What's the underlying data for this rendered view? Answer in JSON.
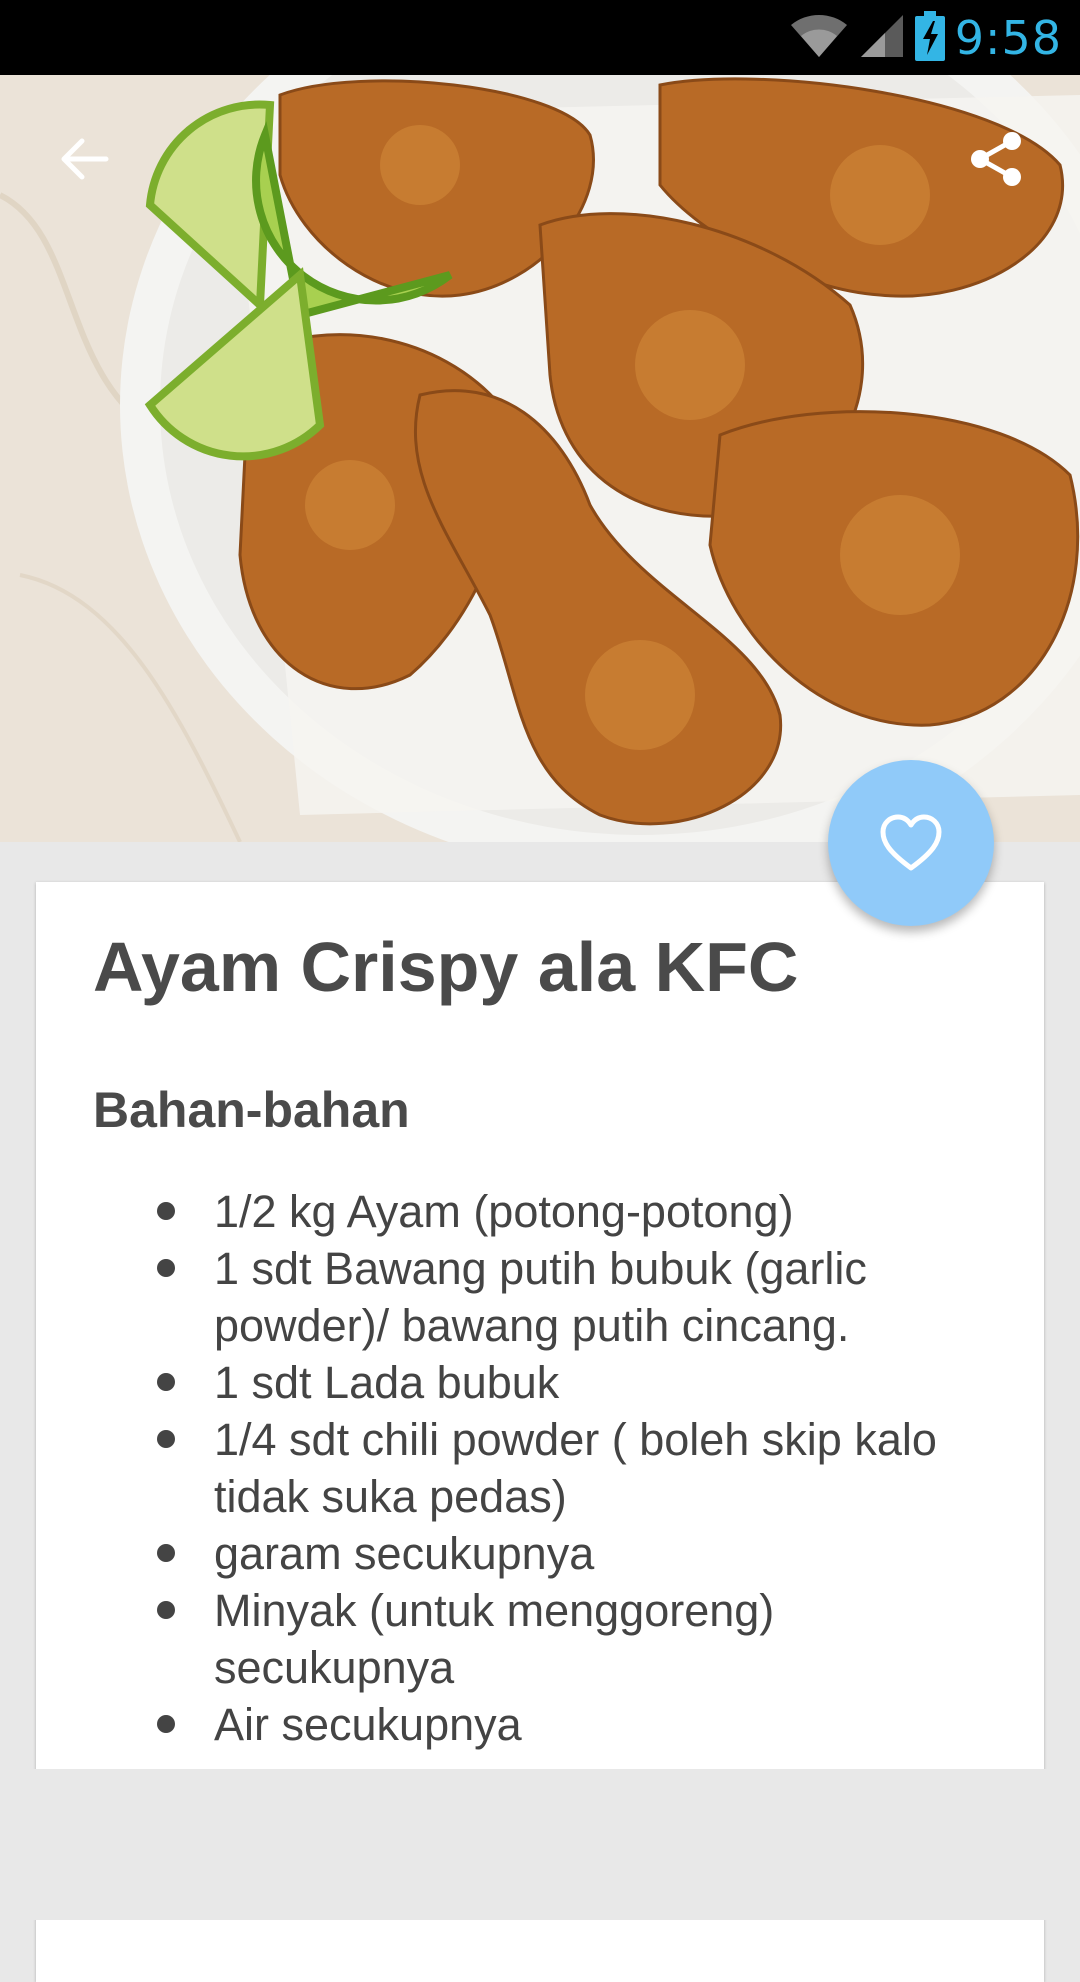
{
  "status_bar": {
    "time": "9:58",
    "icons": [
      "wifi-icon",
      "cell-signal-icon",
      "battery-charging-icon"
    ]
  },
  "header": {
    "back_icon": "arrow-left-icon",
    "share_icon": "share-icon"
  },
  "hero_image": {
    "icon": "fried-chicken-photo"
  },
  "fab": {
    "icon": "heart-outline-icon",
    "color": "#90caf9"
  },
  "recipe": {
    "title": "Ayam Crispy ala KFC",
    "section_heading": "Bahan-bahan",
    "ingredients": [
      "1/2 kg Ayam (potong-potong)",
      "1 sdt Bawang putih bubuk (garlic powder)/ bawang putih cincang.",
      "1 sdt Lada bubuk",
      "1/4 sdt chili powder ( boleh skip kalo tidak suka pedas)",
      "garam secukupnya",
      "Minyak (untuk menggoreng) secukupnya",
      "Air secukupnya"
    ]
  },
  "colors": {
    "status_time": "#33b5e5",
    "background": "#e8e8e8",
    "text": "#4a4a4a"
  }
}
